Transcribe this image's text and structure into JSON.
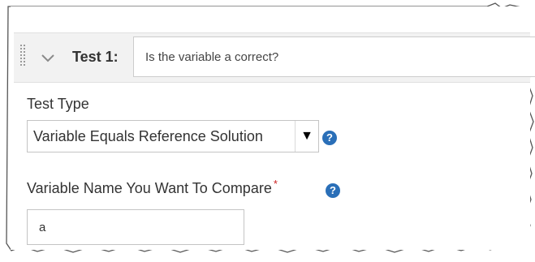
{
  "test": {
    "title": "Test 1:",
    "description": "Is the variable a correct?"
  },
  "test_type": {
    "label": "Test Type",
    "selected": "Variable Equals Reference Solution",
    "arrow": "▼",
    "help": "?"
  },
  "variable_name": {
    "label": "Variable Name You Want To Compare",
    "required_mark": "*",
    "help": "?",
    "value": "a"
  },
  "icons": {
    "drag": "drag-handle-icon",
    "chevron": "chevron-down-icon",
    "help": "help-icon"
  },
  "colors": {
    "help_icon": "#2a6fb8",
    "required": "#cc2222",
    "header_bg": "#f2f2f2"
  }
}
